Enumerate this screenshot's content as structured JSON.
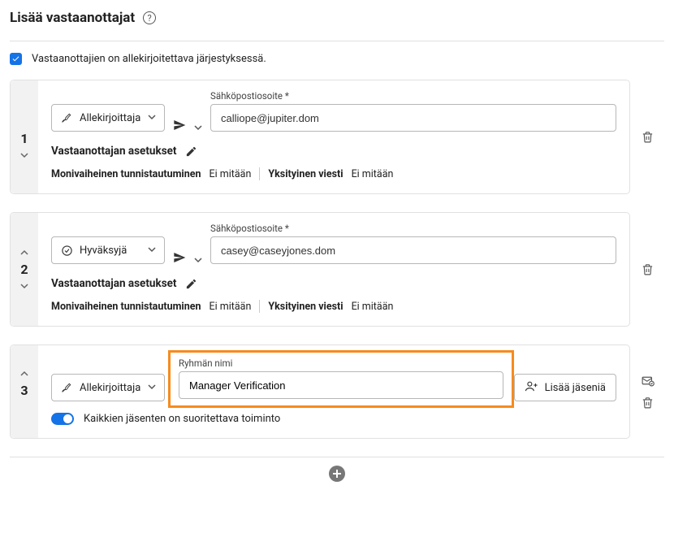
{
  "page_title": "Lisää vastaanottajat",
  "sign_order_label": "Vastaanottajien on allekirjoitettava järjestyksessä.",
  "labels": {
    "email": "Sähköpostiosoite *",
    "group_name": "Ryhmän nimi",
    "recipient_settings": "Vastaanottajan asetukset",
    "mfa": "Monivaiheinen tunnistautuminen",
    "none": "Ei mitään",
    "private_msg": "Yksityinen viesti",
    "add_members": "Lisää jäseniä",
    "all_members_action": "Kaikkien jäsenten on suoritettava toiminto"
  },
  "roles": {
    "signer": "Allekirjoittaja",
    "approver": "Hyväksyjä"
  },
  "recipients": [
    {
      "index": "1",
      "role": "signer",
      "email": "calliope@jupiter.dom"
    },
    {
      "index": "2",
      "role": "approver",
      "email": "casey@caseyjones.dom"
    }
  ],
  "group": {
    "index": "3",
    "role": "signer",
    "name": "Manager Verification"
  }
}
